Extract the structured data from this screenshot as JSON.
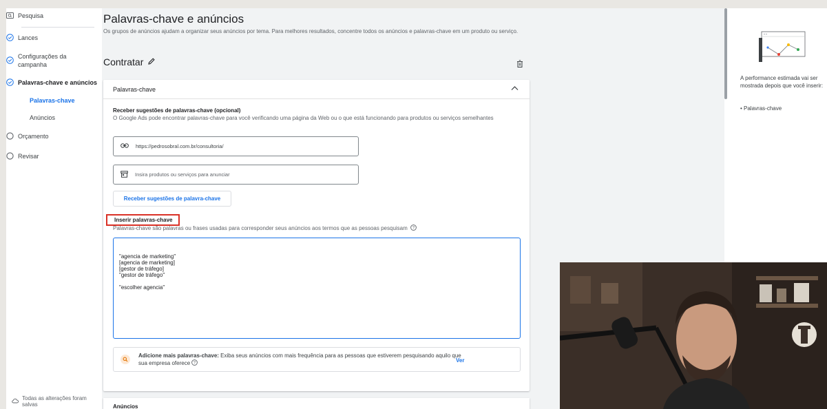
{
  "sidebar": {
    "items": [
      {
        "label": "Pesquisa",
        "icon": "search-box-icon"
      },
      {
        "label": "Lances",
        "icon": "check-circle-icon"
      },
      {
        "label": "Configurações da campanha",
        "icon": "check-circle-icon"
      },
      {
        "label": "Palavras-chave e anúncios",
        "icon": "check-circle-icon"
      },
      {
        "label": "Orçamento",
        "icon": "empty-circle-icon"
      },
      {
        "label": "Revisar",
        "icon": "empty-circle-icon"
      }
    ],
    "sub_items": [
      {
        "label": "Palavras-chave",
        "active": true
      },
      {
        "label": "Anúncios",
        "active": false
      }
    ],
    "config_line1": "Configurações da",
    "config_line2": "campanha",
    "saved_status": "Todas as alterações foram salvas"
  },
  "main": {
    "title": "Palavras-chave e anúncios",
    "description": "Os grupos de anúncios ajudam a organizar seus anúncios por tema. Para melhores resultados, concentre todos os anúncios e palavras-chave em um produto ou serviço.",
    "ad_group_name": "Contratar"
  },
  "keywords_card": {
    "header": "Palavras-chave",
    "suggestions_title": "Receber sugestões de palavras-chave (opcional)",
    "suggestions_desc": "O Google Ads pode encontrar palavras-chave para você verificando uma página da Web ou o que está funcionando para produtos ou serviços semelhantes",
    "url_value": "https://pedrosobral.com.br/consultoria/",
    "products_placeholder": "Insira produtos ou serviços para anunciar",
    "suggestions_button": "Receber sugestões de palavra-chave",
    "insert_label": "Inserir palavras-chave",
    "insert_desc": "Palavras-chave são palavras ou frases usadas para corresponder seus anúncios aos termos que as pessoas pesquisam",
    "keywords_text": "\n\"agencia de marketing\"\n[agencia de marketing]\n[gestor de tráfego]\n\"gestor de tráfego\"\n\n\"escolher agencia\"",
    "tip_bold": "Adicione mais palavras-chave:",
    "tip_text": " Exiba seus anúncios com mais frequência para as pessoas que estiverem pesquisando aquilo que sua empresa oferece",
    "tip_link": "Ver"
  },
  "next_card": {
    "header": "Anúncios"
  },
  "right_panel": {
    "text": "A performance estimada vai ser mostrada depois que você inserir:",
    "list_item": "• Palavras-chave"
  },
  "colors": {
    "accent": "#1a73e8",
    "highlight_box": "#d93025"
  }
}
